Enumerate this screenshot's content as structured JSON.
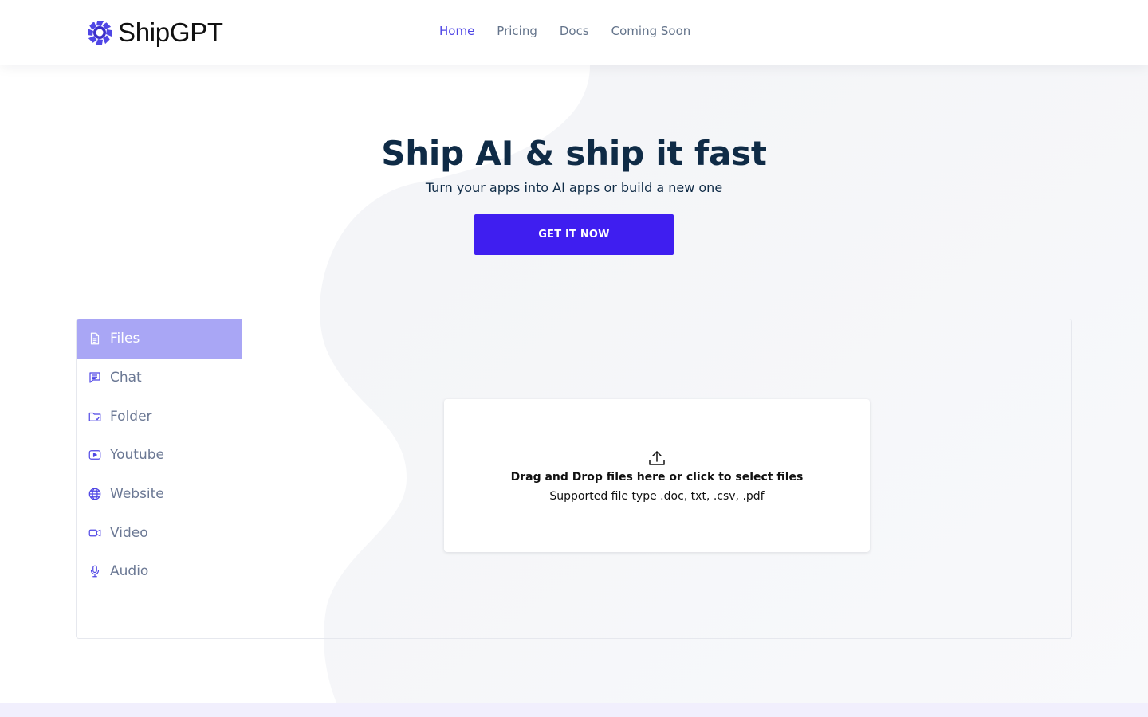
{
  "brand": {
    "name": "ShipGPT",
    "accent": "#3f1ef0",
    "nav_active": "#4f46e5"
  },
  "nav": {
    "items": [
      {
        "label": "Home",
        "active": true
      },
      {
        "label": "Pricing",
        "active": false
      },
      {
        "label": "Docs",
        "active": false
      },
      {
        "label": "Coming Soon",
        "active": false
      }
    ]
  },
  "hero": {
    "title": "Ship AI & ship it fast",
    "subtitle": "Turn your apps into AI apps or build a new one",
    "cta_label": "GET IT NOW"
  },
  "sidebar": {
    "items": [
      {
        "label": "Files",
        "icon": "file-icon",
        "active": true
      },
      {
        "label": "Chat",
        "icon": "chat-icon",
        "active": false
      },
      {
        "label": "Folder",
        "icon": "folder-icon",
        "active": false
      },
      {
        "label": "Youtube",
        "icon": "youtube-icon",
        "active": false
      },
      {
        "label": "Website",
        "icon": "globe-icon",
        "active": false
      },
      {
        "label": "Video",
        "icon": "video-icon",
        "active": false
      },
      {
        "label": "Audio",
        "icon": "microphone-icon",
        "active": false
      }
    ],
    "active_color": "#a9a6f5",
    "icon_color": "#4f46e5"
  },
  "dropzone": {
    "title": "Drag and Drop files here or click to select files",
    "subtitle": "Supported file type .doc, txt, .csv, .pdf",
    "icon": "upload-icon"
  }
}
